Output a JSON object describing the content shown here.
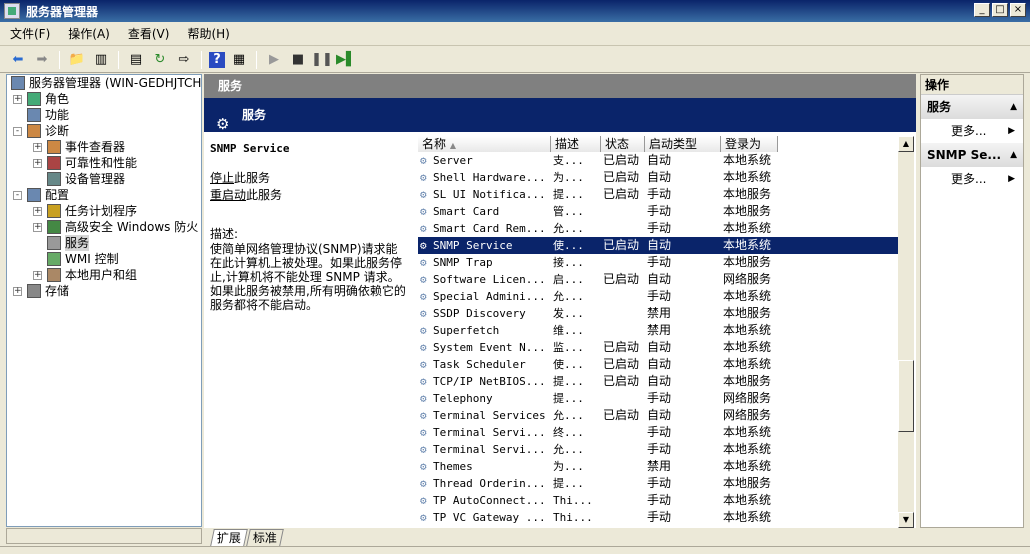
{
  "window": {
    "title": "服务器管理器"
  },
  "menu": [
    "文件(F)",
    "操作(A)",
    "查看(V)",
    "帮助(H)"
  ],
  "tree": [
    {
      "label": "服务器管理器 (WIN-GEDHJTCHMWI",
      "level": 0,
      "expander": ""
    },
    {
      "label": "角色",
      "level": 1,
      "expander": "+"
    },
    {
      "label": "功能",
      "level": 1,
      "expander": ""
    },
    {
      "label": "诊断",
      "level": 1,
      "expander": "-"
    },
    {
      "label": "事件查看器",
      "level": 2,
      "expander": "+"
    },
    {
      "label": "可靠性和性能",
      "level": 2,
      "expander": "+"
    },
    {
      "label": "设备管理器",
      "level": 2,
      "expander": ""
    },
    {
      "label": "配置",
      "level": 1,
      "expander": "-"
    },
    {
      "label": "任务计划程序",
      "level": 2,
      "expander": "+"
    },
    {
      "label": "高级安全 Windows 防火",
      "level": 2,
      "expander": "+"
    },
    {
      "label": "服务",
      "level": 2,
      "expander": "",
      "selected": true
    },
    {
      "label": "WMI 控制",
      "level": 2,
      "expander": ""
    },
    {
      "label": "本地用户和组",
      "level": 2,
      "expander": "+"
    },
    {
      "label": "存储",
      "level": 1,
      "expander": "+"
    }
  ],
  "center": {
    "header": "服务",
    "banner": "服务",
    "selected_service": "SNMP Service",
    "stop_link": "停止",
    "stop_suffix": "此服务",
    "restart_link": "重启动",
    "restart_suffix": "此服务",
    "desc_label": "描述:",
    "desc_text": "使简单网络管理协议(SNMP)请求能在此计算机上被处理。如果此服务停止,计算机将不能处理 SNMP 请求。如果此服务被禁用,所有明确依赖它的服务都将不能启动。"
  },
  "columns": [
    "名称",
    "描述",
    "状态",
    "启动类型",
    "登录为"
  ],
  "services": [
    {
      "name": "Server",
      "desc": "支...",
      "status": "已启动",
      "startup": "自动",
      "logon": "本地系统"
    },
    {
      "name": "Shell Hardware...",
      "desc": "为...",
      "status": "已启动",
      "startup": "自动",
      "logon": "本地系统"
    },
    {
      "name": "SL UI Notifica...",
      "desc": "提...",
      "status": "已启动",
      "startup": "手动",
      "logon": "本地服务"
    },
    {
      "name": "Smart Card",
      "desc": "管...",
      "status": "",
      "startup": "手动",
      "logon": "本地服务"
    },
    {
      "name": "Smart Card Rem...",
      "desc": "允...",
      "status": "",
      "startup": "手动",
      "logon": "本地系统"
    },
    {
      "name": "SNMP Service",
      "desc": "使...",
      "status": "已启动",
      "startup": "自动",
      "logon": "本地系统",
      "selected": true
    },
    {
      "name": "SNMP Trap",
      "desc": "接...",
      "status": "",
      "startup": "手动",
      "logon": "本地服务"
    },
    {
      "name": "Software Licen...",
      "desc": "启...",
      "status": "已启动",
      "startup": "自动",
      "logon": "网络服务"
    },
    {
      "name": "Special Admini...",
      "desc": "允...",
      "status": "",
      "startup": "手动",
      "logon": "本地系统"
    },
    {
      "name": "SSDP Discovery",
      "desc": "发...",
      "status": "",
      "startup": "禁用",
      "logon": "本地服务"
    },
    {
      "name": "Superfetch",
      "desc": "维...",
      "status": "",
      "startup": "禁用",
      "logon": "本地系统"
    },
    {
      "name": "System Event N...",
      "desc": "监...",
      "status": "已启动",
      "startup": "自动",
      "logon": "本地系统"
    },
    {
      "name": "Task Scheduler",
      "desc": "使...",
      "status": "已启动",
      "startup": "自动",
      "logon": "本地系统"
    },
    {
      "name": "TCP/IP NetBIOS...",
      "desc": "提...",
      "status": "已启动",
      "startup": "自动",
      "logon": "本地服务"
    },
    {
      "name": "Telephony",
      "desc": "提...",
      "status": "",
      "startup": "手动",
      "logon": "网络服务"
    },
    {
      "name": "Terminal Services",
      "desc": "允...",
      "status": "已启动",
      "startup": "自动",
      "logon": "网络服务"
    },
    {
      "name": "Terminal Servi...",
      "desc": "终...",
      "status": "",
      "startup": "手动",
      "logon": "本地系统"
    },
    {
      "name": "Terminal Servi...",
      "desc": "允...",
      "status": "",
      "startup": "手动",
      "logon": "本地系统"
    },
    {
      "name": "Themes",
      "desc": "为...",
      "status": "",
      "startup": "禁用",
      "logon": "本地系统"
    },
    {
      "name": "Thread Orderin...",
      "desc": "提...",
      "status": "",
      "startup": "手动",
      "logon": "本地服务"
    },
    {
      "name": "TP AutoConnect...",
      "desc": "Thi...",
      "status": "",
      "startup": "手动",
      "logon": "本地系统"
    },
    {
      "name": "TP VC Gateway ...",
      "desc": "Thi...",
      "status": "",
      "startup": "手动",
      "logon": "本地系统"
    }
  ],
  "tabs": [
    "扩展",
    "标准"
  ],
  "actions": {
    "header": "操作",
    "sections": [
      {
        "title": "服务",
        "item": "更多..."
      },
      {
        "title": "SNMP Se...",
        "item": "更多..."
      }
    ]
  },
  "colors": {
    "selection": "#0a246a",
    "banner": "#0a246a",
    "header_gray": "#808080"
  }
}
